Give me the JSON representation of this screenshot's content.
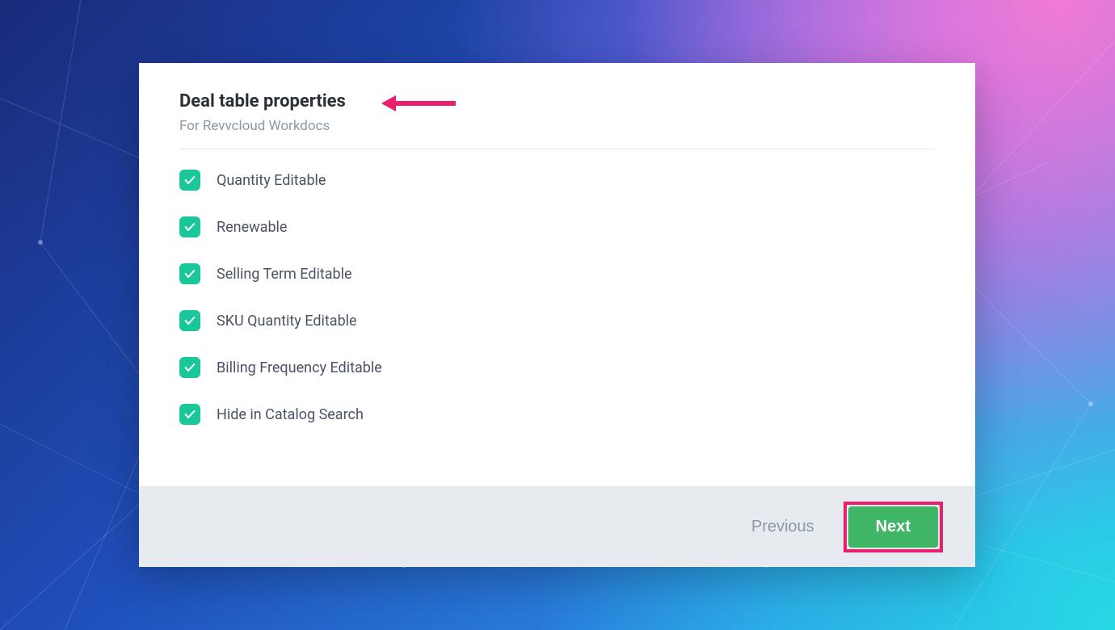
{
  "header": {
    "title": "Deal table properties",
    "subtitle": "For Revvcloud Workdocs"
  },
  "properties": [
    {
      "label": "Quantity Editable",
      "checked": true
    },
    {
      "label": "Renewable",
      "checked": true
    },
    {
      "label": "Selling Term Editable",
      "checked": true
    },
    {
      "label": "SKU Quantity Editable",
      "checked": true
    },
    {
      "label": "Billing Frequency Editable",
      "checked": true
    },
    {
      "label": "Hide in Catalog Search",
      "checked": true
    }
  ],
  "footer": {
    "previous_label": "Previous",
    "next_label": "Next"
  },
  "annotations": {
    "title_arrow_color": "#e91e6d",
    "next_highlight_color": "#e91e6d"
  }
}
